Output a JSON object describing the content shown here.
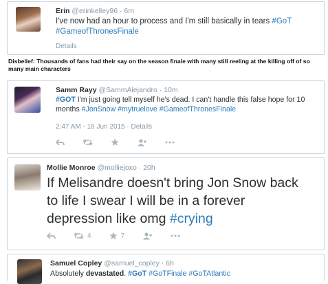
{
  "tweets": [
    {
      "name": "Erin",
      "handle": "@erinkelley96",
      "time": "6m",
      "text_plain": "I've now had an hour to process and I'm still basically in tears ",
      "hashtag1": "#GoT",
      "hashtag2": "#GameofThronesFinale",
      "details": "Details"
    },
    {
      "name": "Samm Rayy",
      "handle": "@SammAlejandro",
      "time": "10m",
      "hashtag_lead": "#GOT",
      "text_line1_rest": " I'm just going tell myself he's dead. I can't handle this false hope for 10",
      "text_line2_plain": "months ",
      "hashtag2": "#JonSnow",
      "hashtag3": "#mytruelove",
      "hashtag4": "#GameofThronesFinale",
      "timestamp": "2:47 AM - 16 Jun 2015",
      "details": "Details"
    },
    {
      "name": "Mollie Monroe",
      "handle": "@molliejoxo",
      "time": "20h",
      "line1": "If Melisandre doesn't bring Jon Snow back",
      "line2": "to life I swear I will be in a forever",
      "line3_plain": "depression like omg ",
      "hashtag": "#crying",
      "retweets": "4",
      "favorites": "7"
    },
    {
      "name": "Samuel Copley",
      "handle": "@samuel_copley",
      "time": "6h",
      "text_plain": "Absolutely ",
      "text_bold": "devastated",
      "text_after": ". ",
      "hashtag1": "#GoT",
      "hashtag2": "#GoTFinale",
      "hashtag3": "#GoTAtlantic"
    }
  ],
  "caption": "Disbelief: Thousands of fans had their say on the season finale with many still reeling at the killing off of so many main characters",
  "colors": {
    "link": "#2b7bb9",
    "meta": "#8899a6",
    "text": "#292f33",
    "border": "#c9d2d8"
  }
}
